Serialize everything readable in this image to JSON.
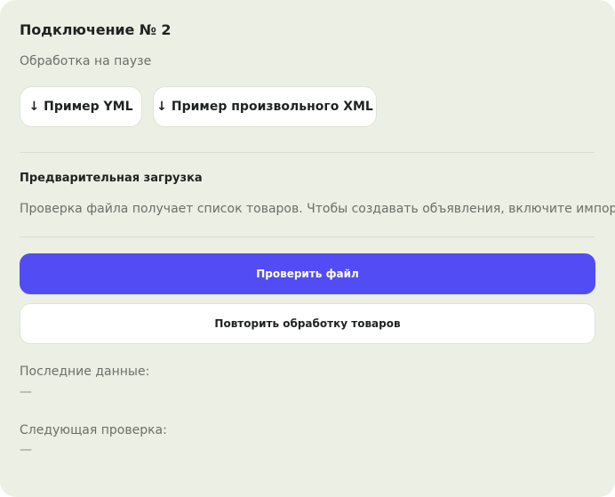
{
  "connection": {
    "title": "Подключение № 2",
    "status": "Обработка на паузе"
  },
  "samples": {
    "arrow_icon": "↓",
    "yml_label": "Пример YML",
    "xml_label": "Пример произвольного XML"
  },
  "preload": {
    "heading": "Предварительная загрузка",
    "description": "Проверка файла получает список товаров. Чтобы создавать объявления, включите импорт."
  },
  "actions": {
    "check_file_label": "Проверить файл",
    "reprocess_label": "Повторить обработку товаров"
  },
  "info": {
    "last_data_label": "Последние данные:",
    "last_data_value": "—",
    "next_check_label": "Следующая проверка:",
    "next_check_value": "—"
  },
  "colors": {
    "card_background": "#ecefe4",
    "primary_button": "#524cf5",
    "text_primary": "#1f2320",
    "text_secondary": "#6b6f68"
  }
}
